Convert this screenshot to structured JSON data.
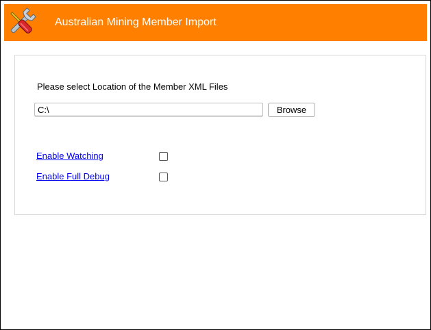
{
  "header": {
    "title": "Australian Mining Member Import",
    "icon": "tools-icon",
    "background_color": "#ff8000"
  },
  "location": {
    "prompt": "Please select Location of the Member XML Files",
    "path_value": "C:\\",
    "browse_label": "Browse"
  },
  "options": [
    {
      "label": "Enable Watching",
      "checked": false
    },
    {
      "label": "Enable Full Debug",
      "checked": false
    }
  ]
}
